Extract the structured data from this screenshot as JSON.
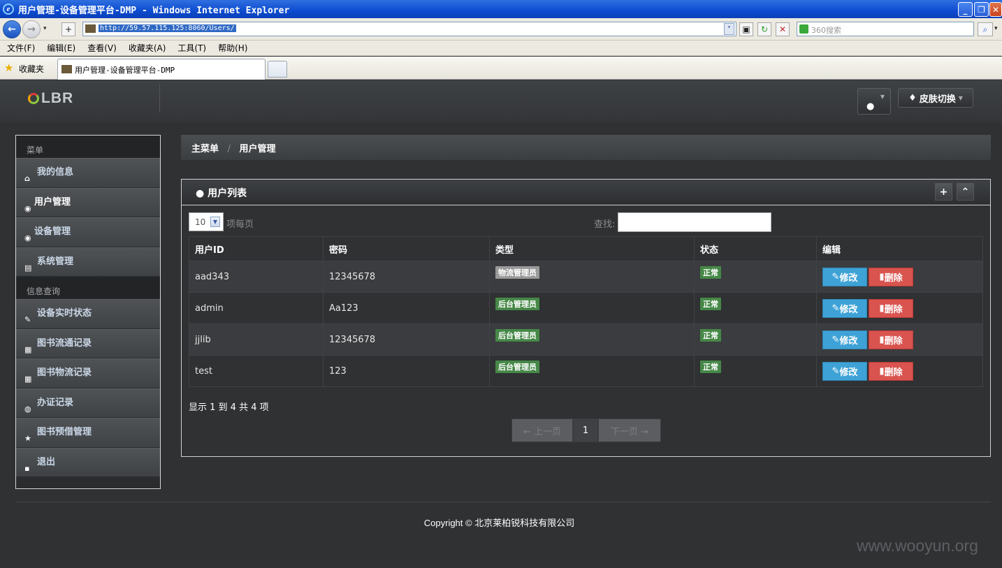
{
  "browser": {
    "title": "用户管理-设备管理平台-DMP - Windows Internet Explorer",
    "url": "http://59.57.115.125:8060/Users/",
    "search_placeholder": "360搜索",
    "menu": [
      "文件(F)",
      "编辑(E)",
      "查看(V)",
      "收藏夹(A)",
      "工具(T)",
      "帮助(H)"
    ],
    "favorites_label": "收藏夹",
    "tab_title": "用户管理-设备管理平台-DMP"
  },
  "header": {
    "logo_text": "LBR",
    "skin_label": "皮肤切换"
  },
  "sidebar": {
    "section_menu": "菜单",
    "section_info": "信息查询",
    "menu_items": [
      {
        "label": "我的信息",
        "icon": "home-icon",
        "glyph": "⌂"
      },
      {
        "label": "用户管理",
        "icon": "eye-icon",
        "glyph": "◉"
      },
      {
        "label": "设备管理",
        "icon": "eye-icon",
        "glyph": "◉"
      },
      {
        "label": "系统管理",
        "icon": "list-icon",
        "glyph": "▤"
      }
    ],
    "info_items": [
      {
        "label": "设备实时状态",
        "icon": "edit-icon",
        "glyph": "✎"
      },
      {
        "label": "图书流通记录",
        "icon": "calendar-icon",
        "glyph": "▦"
      },
      {
        "label": "图书物流记录",
        "icon": "grid-icon",
        "glyph": "▦"
      },
      {
        "label": "办证记录",
        "icon": "globe-icon",
        "glyph": "◍"
      },
      {
        "label": "图书预借管理",
        "icon": "star-icon",
        "glyph": "★"
      },
      {
        "label": "退出",
        "icon": "lock-icon",
        "glyph": "▪"
      }
    ]
  },
  "breadcrumb": {
    "root": "主菜单",
    "sep": "/",
    "current": "用户管理"
  },
  "panel": {
    "title": "用户列表",
    "page_size": "10",
    "page_size_label": "项每页",
    "search_label": "查找:",
    "columns": [
      "用户ID",
      "密码",
      "类型",
      "状态",
      "编辑"
    ],
    "rows": [
      {
        "id": "aad343",
        "password": "12345678",
        "type": "物流管理员",
        "type_color": "grey",
        "status": "正常"
      },
      {
        "id": "admin",
        "password": "Aa123",
        "type": "后台管理员",
        "type_color": "green",
        "status": "正常"
      },
      {
        "id": "jjlib",
        "password": "12345678",
        "type": "后台管理员",
        "type_color": "green",
        "status": "正常"
      },
      {
        "id": "test",
        "password": "123",
        "type": "后台管理员",
        "type_color": "green",
        "status": "正常"
      }
    ],
    "edit_label": "修改",
    "delete_label": "删除",
    "info": "显示 1 到 4 共 4 项",
    "prev": "← 上一页",
    "page": "1",
    "next": "下一页 →"
  },
  "footer": {
    "copyright": "Copyright ©   北京莱柏锐科技有限公司"
  },
  "watermark": "www.wooyun.org",
  "colors": {
    "accent_blue": "#3ea2d6",
    "danger_red": "#d9534f",
    "success_green": "#468847"
  }
}
